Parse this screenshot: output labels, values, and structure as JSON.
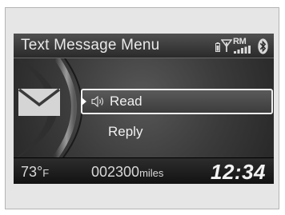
{
  "header": {
    "title": "Text Message Menu",
    "roaming_label": "RM",
    "icons": [
      "phone-battery-icon",
      "antenna-icon",
      "signal-strength-icon",
      "bluetooth-icon"
    ]
  },
  "menu": {
    "items": [
      {
        "label": "Read",
        "selected": true,
        "icon": "speaker-icon"
      },
      {
        "label": "Reply",
        "selected": false
      }
    ],
    "side_icon": "envelope-icon"
  },
  "footer": {
    "temperature": "73°",
    "temperature_unit": "F",
    "odometer": "002300",
    "odometer_unit": "miles",
    "clock": "12:34"
  },
  "colors": {
    "screen_bg": "#000000",
    "text": "#f0f0f0",
    "frame": "#e6e6e6"
  }
}
